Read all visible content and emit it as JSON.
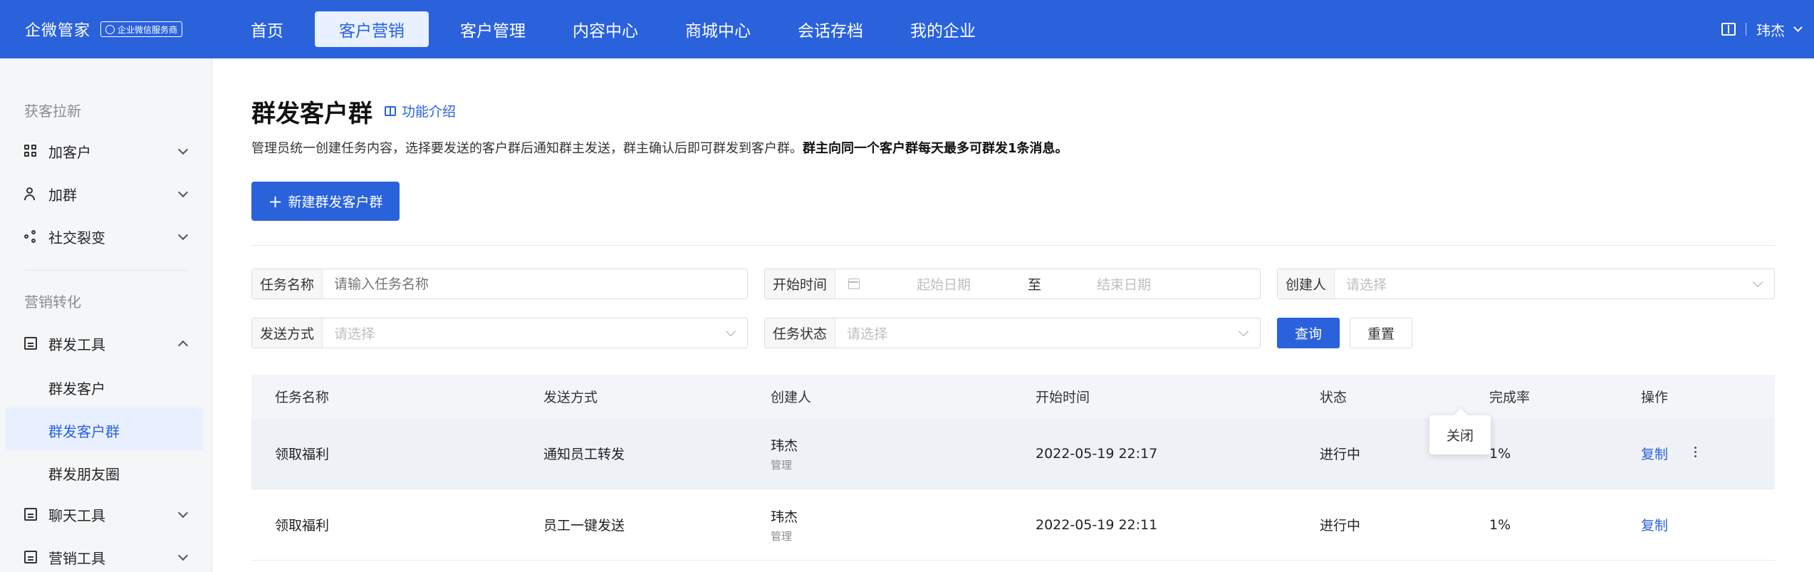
{
  "header": {
    "brand": "企微管家",
    "brand_badge": "企业微信服务商",
    "nav": [
      "首页",
      "客户营销",
      "客户管理",
      "内容中心",
      "商城中心",
      "会话存档",
      "我的企业"
    ],
    "nav_active_index": 1,
    "user": "玮杰"
  },
  "sidebar": {
    "group1": "获客拉新",
    "add_customer": "加客户",
    "add_group": "加群",
    "social_fission": "社交裂变",
    "group2": "营销转化",
    "mass_tool": "群发工具",
    "mass_customer": "群发客户",
    "mass_group": "群发客户群",
    "mass_moments": "群发朋友圈",
    "chat_tool": "聊天工具",
    "marketing_tool": "营销工具"
  },
  "page": {
    "title": "群发客户群",
    "intro_link": "功能介绍",
    "desc_normal": "管理员统一创建任务内容，选择要发送的客户群后通知群主发送，群主确认后即可群发到客户群。",
    "desc_bold": "群主向同一个客户群每天最多可群发1条消息。",
    "new_button_plus": "+",
    "new_button": "新建群发客户群"
  },
  "filters": {
    "task_name_label": "任务名称",
    "task_name_placeholder": "请输入任务名称",
    "start_time_label": "开始时间",
    "start_placeholder": "起始日期",
    "range_sep": "至",
    "end_placeholder": "结束日期",
    "creator_label": "创建人",
    "creator_placeholder": "请选择",
    "send_method_label": "发送方式",
    "send_method_placeholder": "请选择",
    "task_status_label": "任务状态",
    "task_status_placeholder": "请选择",
    "query_button": "查询",
    "reset_button": "重置"
  },
  "table": {
    "columns": [
      "任务名称",
      "发送方式",
      "创建人",
      "开始时间",
      "状态",
      "完成率",
      "操作"
    ],
    "rows": [
      {
        "name": "领取福利",
        "method": "通知员工转发",
        "creator": "玮杰",
        "role": "管理",
        "start": "2022-05-19 22:17",
        "status": "进行中",
        "rate": "1%",
        "action": "复制"
      },
      {
        "name": "领取福利",
        "method": "员工一键发送",
        "creator": "玮杰",
        "role": "管理",
        "start": "2022-05-19 22:11",
        "status": "进行中",
        "rate": "1%",
        "action": "复制"
      }
    ],
    "popover_item": "关闭"
  }
}
